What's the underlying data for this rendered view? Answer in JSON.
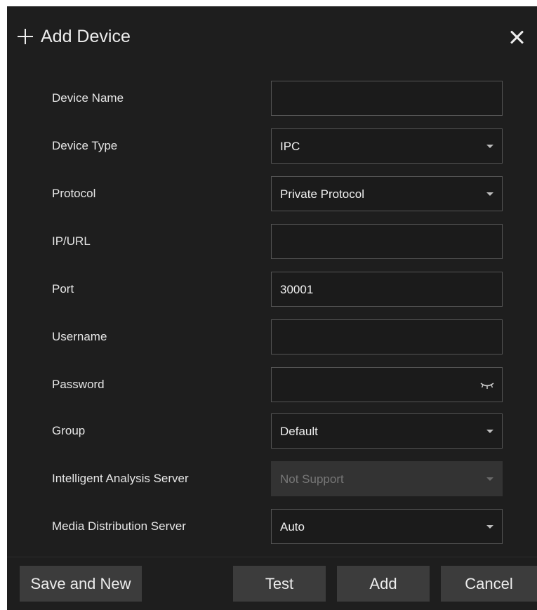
{
  "dialog": {
    "title": "Add Device",
    "plus_icon": "plus-icon",
    "close_icon": "close-icon"
  },
  "form": {
    "device_name": {
      "label": "Device Name",
      "value": ""
    },
    "device_type": {
      "label": "Device Type",
      "value": "IPC"
    },
    "protocol": {
      "label": "Protocol",
      "value": "Private Protocol"
    },
    "ip_url": {
      "label": "IP/URL",
      "value": ""
    },
    "port": {
      "label": "Port",
      "value": "30001"
    },
    "username": {
      "label": "Username",
      "value": ""
    },
    "password": {
      "label": "Password",
      "value": "",
      "icon": "eye-closed-icon"
    },
    "group": {
      "label": "Group",
      "value": "Default"
    },
    "intelligent_analysis_server": {
      "label": "Intelligent Analysis Server",
      "value": "Not Support",
      "disabled": true
    },
    "media_distribution_server": {
      "label": "Media Distribution Server",
      "value": "Auto"
    }
  },
  "buttons": {
    "save_and_new": "Save and New",
    "test": "Test",
    "add": "Add",
    "cancel": "Cancel"
  },
  "colors": {
    "background": "#1e1e1e",
    "field_border": "#555555",
    "button": "#3c3c3c",
    "text": "#ededed"
  }
}
